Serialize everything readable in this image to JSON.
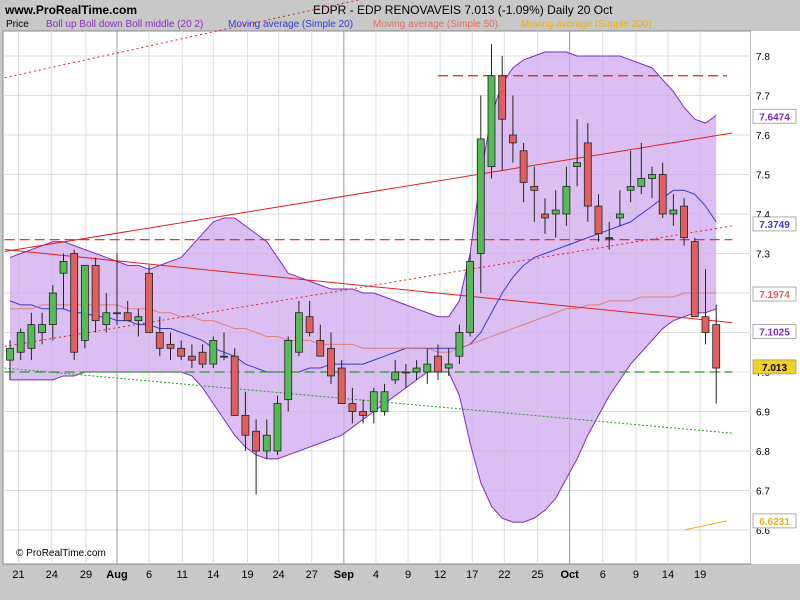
{
  "header": {
    "site": "www.ProRealTime.com",
    "title": "EDPR - EDP RENOVAVEIS    7.013 (-1.09%)    Daily  20 Oct",
    "legend_price": "Price",
    "legend_boll": "Boll up Boll down Boll middle (20 2)",
    "legend_ma20": "Moving average (Simple 20)",
    "legend_ma50": "Moving average (Simple 50)",
    "legend_ma200": "Moving average (Simple 200)",
    "copyright": "© ProRealTime.com"
  },
  "colors": {
    "up": "#55bb55",
    "down": "#e06060",
    "boll": "#cfaaee",
    "boll_line": "#7a2fc0",
    "ma20": "#3a3ad0",
    "ma50": "#e07060",
    "ma200": "#e8b020",
    "trend": "#e02020",
    "support": "#20a020"
  },
  "chart_data": {
    "type": "candlestick",
    "ylim": [
      6.6,
      7.85
    ],
    "yticks": [
      "7.8",
      "7.7",
      "7.6",
      "7.5",
      "7.4",
      "7.3",
      "7.2",
      "7.1",
      "7.0",
      "6.9",
      "6.8",
      "6.7",
      "6.6"
    ],
    "xticks": [
      "21",
      "24",
      "29",
      "Aug",
      "6",
      "11",
      "14",
      "19",
      "24",
      "27",
      "Sep",
      "4",
      "9",
      "12",
      "17",
      "22",
      "25",
      "Oct",
      "6",
      "9",
      "14",
      "19"
    ],
    "price_labels": [
      {
        "text": "7.6474",
        "value": 7.6474,
        "color": "#7a2fc0"
      },
      {
        "text": "7.3749",
        "value": 7.3749,
        "color": "#3a3ad0"
      },
      {
        "text": "7.1974",
        "value": 7.1974,
        "color": "#e06060"
      },
      {
        "text": "7.1025",
        "value": 7.1025,
        "color": "#7a2fc0"
      },
      {
        "text": "7.013",
        "value": 7.013,
        "color": "#000000",
        "bg": "#f0d020"
      },
      {
        "text": "6.6231",
        "value": 6.6231,
        "color": "#e8b020"
      }
    ],
    "candles": [
      {
        "o": 7.03,
        "h": 7.08,
        "l": 6.98,
        "c": 7.06
      },
      {
        "o": 7.05,
        "h": 7.11,
        "l": 7.03,
        "c": 7.1
      },
      {
        "o": 7.06,
        "h": 7.15,
        "l": 7.03,
        "c": 7.12
      },
      {
        "o": 7.1,
        "h": 7.15,
        "l": 7.07,
        "c": 7.12
      },
      {
        "o": 7.12,
        "h": 7.22,
        "l": 7.08,
        "c": 7.2
      },
      {
        "o": 7.25,
        "h": 7.3,
        "l": 7.16,
        "c": 7.28
      },
      {
        "o": 7.3,
        "h": 7.31,
        "l": 7.03,
        "c": 7.05
      },
      {
        "o": 7.08,
        "h": 7.22,
        "l": 7.06,
        "c": 7.27
      },
      {
        "o": 7.27,
        "h": 7.29,
        "l": 7.1,
        "c": 7.13
      },
      {
        "o": 7.12,
        "h": 7.2,
        "l": 7.1,
        "c": 7.15
      },
      {
        "o": 7.15,
        "h": 7.3,
        "l": 7.12,
        "c": 7.15
      },
      {
        "o": 7.15,
        "h": 7.18,
        "l": 7.13,
        "c": 7.13
      },
      {
        "o": 7.13,
        "h": 7.16,
        "l": 7.09,
        "c": 7.14
      },
      {
        "o": 7.25,
        "h": 7.27,
        "l": 7.1,
        "c": 7.1
      },
      {
        "o": 7.1,
        "h": 7.14,
        "l": 7.04,
        "c": 7.06
      },
      {
        "o": 7.07,
        "h": 7.1,
        "l": 7.03,
        "c": 7.06
      },
      {
        "o": 7.06,
        "h": 7.08,
        "l": 7.03,
        "c": 7.04
      },
      {
        "o": 7.04,
        "h": 7.07,
        "l": 7.01,
        "c": 7.03
      },
      {
        "o": 7.05,
        "h": 7.07,
        "l": 7.01,
        "c": 7.02
      },
      {
        "o": 7.02,
        "h": 7.09,
        "l": 7.01,
        "c": 7.08
      },
      {
        "o": 7.04,
        "h": 7.1,
        "l": 7.03,
        "c": 7.04
      },
      {
        "o": 7.04,
        "h": 7.06,
        "l": 6.94,
        "c": 6.89
      },
      {
        "o": 6.89,
        "h": 6.95,
        "l": 6.8,
        "c": 6.84
      },
      {
        "o": 6.85,
        "h": 6.88,
        "l": 6.69,
        "c": 6.8
      },
      {
        "o": 6.8,
        "h": 6.88,
        "l": 6.78,
        "c": 6.84
      },
      {
        "o": 6.8,
        "h": 6.94,
        "l": 6.79,
        "c": 6.92
      },
      {
        "o": 6.93,
        "h": 7.09,
        "l": 6.9,
        "c": 7.08
      },
      {
        "o": 7.05,
        "h": 7.18,
        "l": 7.04,
        "c": 7.15
      },
      {
        "o": 7.14,
        "h": 7.18,
        "l": 7.09,
        "c": 7.1
      },
      {
        "o": 7.08,
        "h": 7.12,
        "l": 7.04,
        "c": 7.04
      },
      {
        "o": 7.06,
        "h": 7.1,
        "l": 6.97,
        "c": 6.99
      },
      {
        "o": 7.01,
        "h": 7.03,
        "l": 6.93,
        "c": 6.92
      },
      {
        "o": 6.92,
        "h": 6.96,
        "l": 6.87,
        "c": 6.9
      },
      {
        "o": 6.9,
        "h": 6.93,
        "l": 6.87,
        "c": 6.89
      },
      {
        "o": 6.9,
        "h": 6.96,
        "l": 6.87,
        "c": 6.95
      },
      {
        "o": 6.9,
        "h": 6.97,
        "l": 6.89,
        "c": 6.95
      },
      {
        "o": 6.98,
        "h": 7.03,
        "l": 6.97,
        "c": 7.0
      },
      {
        "o": 7.0,
        "h": 7.02,
        "l": 6.96,
        "c": 7.0
      },
      {
        "o": 7.0,
        "h": 7.03,
        "l": 6.98,
        "c": 7.01
      },
      {
        "o": 7.0,
        "h": 7.06,
        "l": 6.97,
        "c": 7.02
      },
      {
        "o": 7.04,
        "h": 7.07,
        "l": 6.98,
        "c": 7.0
      },
      {
        "o": 7.01,
        "h": 7.06,
        "l": 6.99,
        "c": 7.02
      },
      {
        "o": 7.04,
        "h": 7.12,
        "l": 7.02,
        "c": 7.1
      },
      {
        "o": 7.1,
        "h": 7.3,
        "l": 7.09,
        "c": 7.28
      },
      {
        "o": 7.3,
        "h": 7.7,
        "l": 7.2,
        "c": 7.59
      },
      {
        "o": 7.52,
        "h": 7.83,
        "l": 7.49,
        "c": 7.75
      },
      {
        "o": 7.75,
        "h": 7.8,
        "l": 7.51,
        "c": 7.64
      },
      {
        "o": 7.6,
        "h": 7.7,
        "l": 7.53,
        "c": 7.58
      },
      {
        "o": 7.56,
        "h": 7.58,
        "l": 7.43,
        "c": 7.48
      },
      {
        "o": 7.47,
        "h": 7.52,
        "l": 7.38,
        "c": 7.46
      },
      {
        "o": 7.4,
        "h": 7.44,
        "l": 7.35,
        "c": 7.39
      },
      {
        "o": 7.4,
        "h": 7.46,
        "l": 7.34,
        "c": 7.41
      },
      {
        "o": 7.4,
        "h": 7.52,
        "l": 7.37,
        "c": 7.47
      },
      {
        "o": 7.52,
        "h": 7.64,
        "l": 7.47,
        "c": 7.53
      },
      {
        "o": 7.58,
        "h": 7.63,
        "l": 7.38,
        "c": 7.42
      },
      {
        "o": 7.42,
        "h": 7.45,
        "l": 7.33,
        "c": 7.35
      },
      {
        "o": 7.34,
        "h": 7.38,
        "l": 7.31,
        "c": 7.34
      },
      {
        "o": 7.39,
        "h": 7.46,
        "l": 7.37,
        "c": 7.4
      },
      {
        "o": 7.46,
        "h": 7.56,
        "l": 7.43,
        "c": 7.47
      },
      {
        "o": 7.47,
        "h": 7.58,
        "l": 7.45,
        "c": 7.49
      },
      {
        "o": 7.49,
        "h": 7.52,
        "l": 7.44,
        "c": 7.5
      },
      {
        "o": 7.5,
        "h": 7.53,
        "l": 7.39,
        "c": 7.4
      },
      {
        "o": 7.4,
        "h": 7.45,
        "l": 7.37,
        "c": 7.41
      },
      {
        "o": 7.42,
        "h": 7.44,
        "l": 7.32,
        "c": 7.34
      },
      {
        "o": 7.33,
        "h": 7.34,
        "l": 7.15,
        "c": 7.14
      },
      {
        "o": 7.14,
        "h": 7.26,
        "l": 7.07,
        "c": 7.1
      },
      {
        "o": 7.12,
        "h": 7.17,
        "l": 6.92,
        "c": 7.01
      }
    ],
    "bollinger_upper": [
      7.29,
      7.3,
      7.31,
      7.32,
      7.33,
      7.33,
      7.32,
      7.31,
      7.3,
      7.29,
      7.28,
      7.27,
      7.27,
      7.26,
      7.27,
      7.28,
      7.29,
      7.32,
      7.35,
      7.38,
      7.39,
      7.39,
      7.37,
      7.35,
      7.33,
      7.29,
      7.25,
      7.24,
      7.23,
      7.22,
      7.21,
      7.21,
      7.21,
      7.2,
      7.2,
      7.19,
      7.18,
      7.17,
      7.16,
      7.15,
      7.14,
      7.14,
      7.18,
      7.3,
      7.5,
      7.65,
      7.73,
      7.77,
      7.79,
      7.8,
      7.81,
      7.81,
      7.81,
      7.8,
      7.8,
      7.8,
      7.8,
      7.8,
      7.79,
      7.78,
      7.77,
      7.74,
      7.71,
      7.67,
      7.64,
      7.63,
      7.65
    ],
    "bollinger_lower": [
      6.98,
      6.98,
      6.98,
      6.98,
      6.98,
      6.99,
      6.99,
      7.0,
      7.0,
      7.0,
      7.0,
      7.0,
      7.0,
      7.0,
      7.0,
      7.0,
      7.0,
      6.99,
      6.96,
      6.92,
      6.88,
      6.84,
      6.81,
      6.79,
      6.78,
      6.78,
      6.79,
      6.8,
      6.81,
      6.82,
      6.83,
      6.84,
      6.86,
      6.88,
      6.9,
      6.92,
      6.94,
      6.96,
      6.98,
      7.0,
      7.0,
      7.0,
      6.94,
      6.82,
      6.72,
      6.66,
      6.63,
      6.62,
      6.62,
      6.63,
      6.65,
      6.68,
      6.73,
      6.78,
      6.84,
      6.89,
      6.94,
      6.98,
      7.02,
      7.05,
      7.08,
      7.11,
      7.13,
      7.14,
      7.15,
      7.15,
      7.16
    ],
    "ma20": [
      7.18,
      7.17,
      7.17,
      7.16,
      7.16,
      7.16,
      7.15,
      7.15,
      7.14,
      7.14,
      7.13,
      7.13,
      7.12,
      7.12,
      7.11,
      7.11,
      7.1,
      7.09,
      7.08,
      7.06,
      7.05,
      7.04,
      7.02,
      7.01,
      7.0,
      7.0,
      7.0,
      7.0,
      7.01,
      7.01,
      7.02,
      7.02,
      7.02,
      7.02,
      7.03,
      7.04,
      7.05,
      7.06,
      7.06,
      7.06,
      7.06,
      7.06,
      7.06,
      7.07,
      7.1,
      7.15,
      7.2,
      7.24,
      7.27,
      7.29,
      7.3,
      7.31,
      7.32,
      7.33,
      7.34,
      7.35,
      7.36,
      7.37,
      7.38,
      7.4,
      7.42,
      7.44,
      7.46,
      7.46,
      7.45,
      7.42,
      7.38
    ],
    "ma50": [
      7.16,
      7.16,
      7.16,
      7.17,
      7.17,
      7.17,
      7.17,
      7.17,
      7.17,
      7.17,
      7.17,
      7.16,
      7.16,
      7.16,
      7.15,
      7.15,
      7.14,
      7.14,
      7.13,
      7.13,
      7.12,
      7.11,
      7.11,
      7.1,
      7.09,
      7.09,
      7.08,
      7.08,
      7.08,
      7.07,
      7.07,
      7.07,
      7.07,
      7.06,
      7.06,
      7.06,
      7.06,
      7.06,
      7.06,
      7.06,
      7.05,
      7.05,
      7.06,
      7.07,
      7.08,
      7.09,
      7.1,
      7.11,
      7.12,
      7.13,
      7.14,
      7.15,
      7.16,
      7.16,
      7.17,
      7.17,
      7.18,
      7.18,
      7.18,
      7.19,
      7.19,
      7.19,
      7.19,
      7.2,
      7.2,
      7.2,
      7.2
    ],
    "ma200": [
      {
        "x": 63,
        "y": 6.6
      },
      {
        "x": 67,
        "y": 6.623
      }
    ],
    "horizontal_lines": [
      {
        "y": 7.75,
        "color": "#e02020",
        "dash": "10,5",
        "from": 40,
        "to": 67
      },
      {
        "y": 7.335,
        "color": "#e02020",
        "dash": "10,5",
        "from": -0.5,
        "to": 67.5
      },
      {
        "y": 7.0,
        "color": "#20a020",
        "dash": "10,5",
        "from": -0.5,
        "to": 67.5
      }
    ],
    "trend_lines": [
      {
        "x1": -0.5,
        "y1": 7.305,
        "x2": 67.5,
        "y2": 7.605,
        "color": "#e02020",
        "dash": ""
      },
      {
        "x1": -0.5,
        "y1": 7.31,
        "x2": 67.5,
        "y2": 7.125,
        "color": "#e02020",
        "dash": ""
      },
      {
        "x1": -0.5,
        "y1": 7.745,
        "x2": 67.5,
        "y2": 8.15,
        "color": "#e02020",
        "dash": "2,3"
      },
      {
        "x1": -0.5,
        "y1": 7.065,
        "x2": 67.5,
        "y2": 7.37,
        "color": "#e02020",
        "dash": "2,3"
      },
      {
        "x1": -0.5,
        "y1": 7.01,
        "x2": 67.5,
        "y2": 6.845,
        "color": "#20a020",
        "dash": "2,2"
      }
    ]
  }
}
